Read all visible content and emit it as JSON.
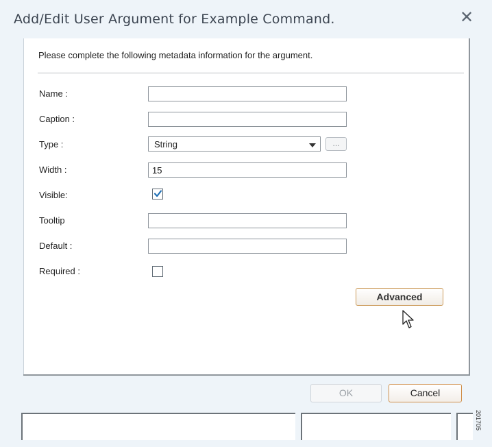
{
  "dialog": {
    "title": "Add/Edit User Argument for Example Command.",
    "close_icon": "close-icon",
    "intro": "Please complete the following metadata information for the argument."
  },
  "form": {
    "name": {
      "label": "Name :",
      "value": ""
    },
    "caption": {
      "label": "Caption :",
      "value": ""
    },
    "type": {
      "label": "Type :",
      "value": "String",
      "ellipsis": "..."
    },
    "width": {
      "label": "Width :",
      "value": "15"
    },
    "visible": {
      "label": "Visible:",
      "checked": true
    },
    "tooltip": {
      "label": "Tooltip",
      "value": ""
    },
    "default": {
      "label": "Default :",
      "value": ""
    },
    "required": {
      "label": "Required :",
      "checked": false
    }
  },
  "buttons": {
    "advanced": "Advanced",
    "ok": "OK",
    "cancel": "Cancel"
  },
  "watermark": "201705",
  "colors": {
    "accent_border": "#cc9a59",
    "check_color": "#1f6fb5",
    "dialog_bg": "#eef4f9"
  }
}
